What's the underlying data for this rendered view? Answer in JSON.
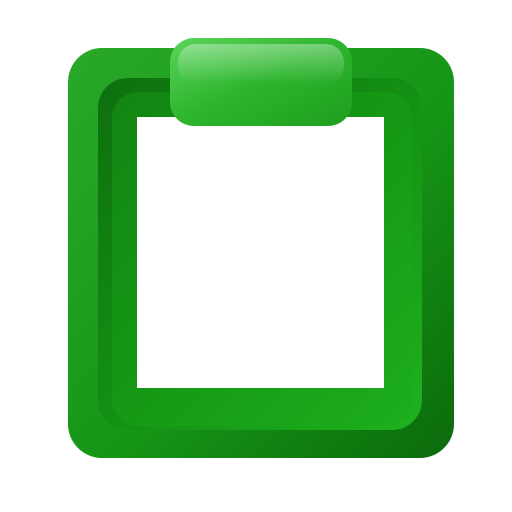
{
  "icon": {
    "name": "clipboard-icon",
    "colors": {
      "board_light": "#2cb52c",
      "board_mid": "#1a9e1a",
      "board_dark": "#0b6a0b",
      "inner_shadow": "#0f7a0f",
      "clip_light": "#4fce4f",
      "clip_dark": "#22a722",
      "paper": "#ffffff",
      "background": "#ffffff"
    }
  }
}
